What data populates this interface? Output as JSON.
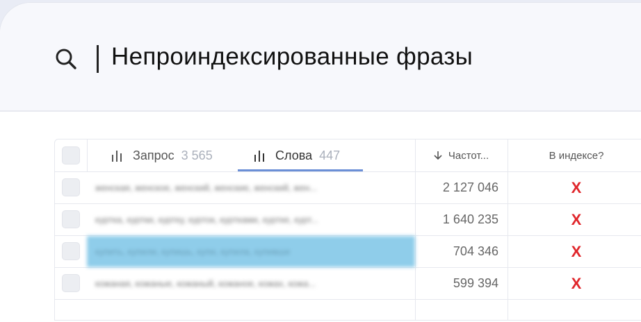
{
  "search": {
    "title": "Непроиндексированные фразы"
  },
  "tabs": [
    {
      "label": "Запрос",
      "count": "3 565"
    },
    {
      "label": "Слова",
      "count": "447"
    }
  ],
  "columns": {
    "frequency": "Частот...",
    "in_index": "В индексе?"
  },
  "rows": [
    {
      "phrase": "женская, женское, женский, женские, женский, жен...",
      "frequency": "2 127 046",
      "in_index": "X"
    },
    {
      "phrase": "куртка, куртки, куртку, курток, куртками, куртке, курт...",
      "frequency": "1 640 235",
      "in_index": "X"
    },
    {
      "phrase": "купить, купили, купишь, купи, купила, купивши",
      "frequency": "704 346",
      "in_index": "X"
    },
    {
      "phrase": "кожаная, кожаные, кожаный, кожаное, кожах, кожа...",
      "frequency": "599 394",
      "in_index": "X"
    }
  ],
  "colors": {
    "accent": "#6b8fd6",
    "selected_row": "#8fcdea",
    "not_indexed": "#e0262b"
  },
  "icons": {
    "search": "search-icon",
    "tab": "bar-chart-icon",
    "sort": "arrow-down-icon"
  }
}
